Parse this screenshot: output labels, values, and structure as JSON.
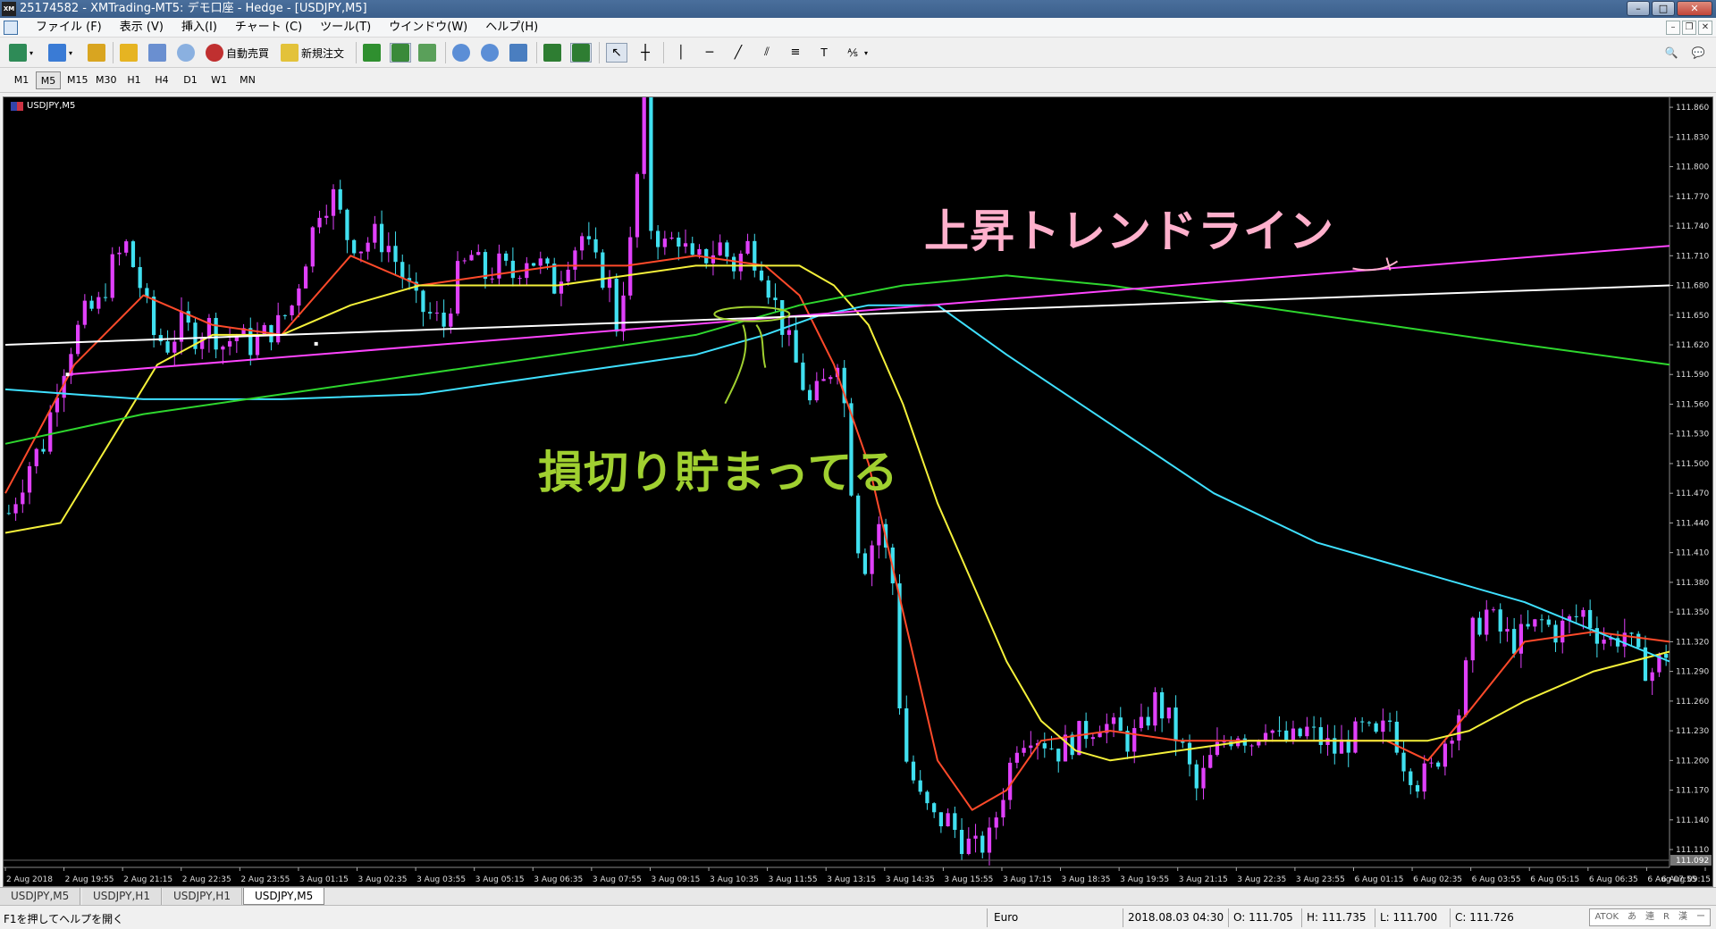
{
  "window": {
    "app_icon": "XM",
    "title": "25174582 - XMTrading-MT5: デモ口座 - Hedge - [USDJPY,M5]",
    "buttons": [
      "–",
      "□",
      "✕"
    ]
  },
  "menu": {
    "items": [
      "ファイル (F)",
      "表示 (V)",
      "挿入(I)",
      "チャート (C)",
      "ツール(T)",
      "ウインドウ(W)",
      "ヘルプ(H)"
    ],
    "mdi_buttons": [
      "–",
      "❐",
      "✕"
    ]
  },
  "toolbar": {
    "auto_trade_label": "自動売買",
    "new_order_label": "新規注文"
  },
  "timeframes": [
    "M1",
    "M5",
    "M15",
    "M30",
    "H1",
    "H4",
    "D1",
    "W1",
    "MN"
  ],
  "active_timeframe": "M5",
  "chart": {
    "symbol_label": "USDJPY,M5",
    "annotation_trend": "上昇トレンドライン",
    "annotation_stop": "損切り貯まってる",
    "current_price_label": "111.092"
  },
  "chart_data": {
    "type": "candlestick",
    "symbol": "USDJPY",
    "timeframe": "M5",
    "price_ticks": [
      "111.860",
      "111.830",
      "111.800",
      "111.770",
      "111.740",
      "111.710",
      "111.680",
      "111.650",
      "111.620",
      "111.590",
      "111.560",
      "111.530",
      "111.500",
      "111.470",
      "111.440",
      "111.410",
      "111.380",
      "111.350",
      "111.320",
      "111.290",
      "111.260",
      "111.230",
      "111.200",
      "111.170",
      "111.140",
      "111.110"
    ],
    "time_ticks": [
      "2 Aug 2018",
      "2 Aug 19:55",
      "2 Aug 21:15",
      "2 Aug 22:35",
      "2 Aug 23:55",
      "3 Aug 01:15",
      "3 Aug 02:35",
      "3 Aug 03:55",
      "3 Aug 05:15",
      "3 Aug 06:35",
      "3 Aug 07:55",
      "3 Aug 09:15",
      "3 Aug 10:35",
      "3 Aug 11:55",
      "3 Aug 13:15",
      "3 Aug 14:35",
      "3 Aug 15:55",
      "3 Aug 17:15",
      "3 Aug 18:35",
      "3 Aug 19:55",
      "3 Aug 21:15",
      "3 Aug 22:35",
      "3 Aug 23:55",
      "6 Aug 01:15",
      "6 Aug 02:35",
      "6 Aug 03:55",
      "6 Aug 05:15",
      "6 Aug 06:35",
      "6 Aug 07:55",
      "6 Aug 09:15"
    ],
    "ylim": [
      111.092,
      111.87
    ],
    "close_path": [
      [
        0,
        111.45
      ],
      [
        3,
        111.5
      ],
      [
        5,
        111.52
      ],
      [
        7,
        111.58
      ],
      [
        9,
        111.62
      ],
      [
        11,
        111.65
      ],
      [
        13,
        111.66
      ],
      [
        15,
        111.7
      ],
      [
        17,
        111.72
      ],
      [
        19,
        111.68
      ],
      [
        21,
        111.63
      ],
      [
        23,
        111.62
      ],
      [
        25,
        111.64
      ],
      [
        27,
        111.63
      ],
      [
        29,
        111.64
      ],
      [
        31,
        111.62
      ],
      [
        33,
        111.63
      ],
      [
        35,
        111.62
      ],
      [
        37,
        111.63
      ],
      [
        39,
        111.64
      ],
      [
        41,
        111.66
      ],
      [
        43,
        111.71
      ],
      [
        45,
        111.76
      ],
      [
        47,
        111.77
      ],
      [
        49,
        111.73
      ],
      [
        51,
        111.72
      ],
      [
        53,
        111.73
      ],
      [
        55,
        111.72
      ],
      [
        57,
        111.69
      ],
      [
        59,
        111.66
      ],
      [
        61,
        111.65
      ],
      [
        63,
        111.64
      ],
      [
        65,
        111.69
      ],
      [
        67,
        111.71
      ],
      [
        69,
        111.69
      ],
      [
        71,
        111.7
      ],
      [
        73,
        111.69
      ],
      [
        75,
        111.71
      ],
      [
        77,
        111.7
      ],
      [
        79,
        111.68
      ],
      [
        81,
        111.71
      ],
      [
        83,
        111.73
      ],
      [
        85,
        111.7
      ],
      [
        87,
        111.68
      ],
      [
        88,
        111.64
      ],
      [
        90,
        111.72
      ],
      [
        92,
        111.86
      ],
      [
        93,
        111.74
      ],
      [
        95,
        111.72
      ],
      [
        97,
        111.73
      ],
      [
        99,
        111.7
      ],
      [
        101,
        111.71
      ],
      [
        103,
        111.72
      ],
      [
        105,
        111.7
      ],
      [
        107,
        111.72
      ],
      [
        109,
        111.7
      ],
      [
        111,
        111.66
      ],
      [
        112,
        111.64
      ],
      [
        114,
        111.6
      ],
      [
        116,
        111.56
      ],
      [
        118,
        111.58
      ],
      [
        120,
        111.61
      ],
      [
        121,
        111.56
      ],
      [
        122,
        111.48
      ],
      [
        123,
        111.42
      ],
      [
        124,
        111.4
      ],
      [
        126,
        111.44
      ],
      [
        128,
        111.38
      ],
      [
        129,
        111.26
      ],
      [
        130,
        111.2
      ],
      [
        132,
        111.16
      ],
      [
        134,
        111.14
      ],
      [
        136,
        111.14
      ],
      [
        138,
        111.12
      ],
      [
        140,
        111.11
      ],
      [
        142,
        111.12
      ],
      [
        144,
        111.17
      ],
      [
        146,
        111.22
      ],
      [
        148,
        111.23
      ],
      [
        150,
        111.22
      ],
      [
        152,
        111.21
      ],
      [
        154,
        111.22
      ],
      [
        156,
        111.23
      ],
      [
        158,
        111.24
      ],
      [
        160,
        111.23
      ],
      [
        162,
        111.22
      ],
      [
        164,
        111.23
      ],
      [
        166,
        111.26
      ],
      [
        168,
        111.24
      ],
      [
        170,
        111.21
      ],
      [
        172,
        111.17
      ],
      [
        174,
        111.2
      ],
      [
        176,
        111.22
      ],
      [
        178,
        111.23
      ],
      [
        180,
        111.22
      ],
      [
        182,
        111.24
      ],
      [
        184,
        111.22
      ],
      [
        186,
        111.22
      ],
      [
        188,
        111.23
      ],
      [
        190,
        111.22
      ],
      [
        192,
        111.21
      ],
      [
        194,
        111.22
      ],
      [
        196,
        111.23
      ],
      [
        198,
        111.22
      ],
      [
        200,
        111.24
      ],
      [
        202,
        111.2
      ],
      [
        204,
        111.18
      ],
      [
        206,
        111.19
      ],
      [
        208,
        111.22
      ],
      [
        210,
        111.25
      ],
      [
        212,
        111.33
      ],
      [
        214,
        111.35
      ],
      [
        216,
        111.33
      ],
      [
        218,
        111.32
      ],
      [
        220,
        111.33
      ],
      [
        222,
        111.34
      ],
      [
        224,
        111.33
      ],
      [
        226,
        111.34
      ],
      [
        228,
        111.35
      ],
      [
        230,
        111.33
      ],
      [
        232,
        111.32
      ],
      [
        234,
        111.33
      ],
      [
        236,
        111.3
      ],
      [
        238,
        111.29
      ],
      [
        240,
        111.31
      ],
      [
        241,
        111.28
      ]
    ],
    "series": [
      {
        "name": "",
        "color": "#ff4a2a",
        "values": [
          [
            0,
            111.47
          ],
          [
            10,
            111.6
          ],
          [
            20,
            111.67
          ],
          [
            30,
            111.64
          ],
          [
            40,
            111.63
          ],
          [
            50,
            111.71
          ],
          [
            60,
            111.68
          ],
          [
            70,
            111.69
          ],
          [
            80,
            111.7
          ],
          [
            90,
            111.7
          ],
          [
            100,
            111.71
          ],
          [
            110,
            111.7
          ],
          [
            115,
            111.67
          ],
          [
            120,
            111.6
          ],
          [
            125,
            111.5
          ],
          [
            130,
            111.35
          ],
          [
            135,
            111.2
          ],
          [
            140,
            111.15
          ],
          [
            145,
            111.17
          ],
          [
            150,
            111.22
          ],
          [
            160,
            111.23
          ],
          [
            170,
            111.22
          ],
          [
            180,
            111.22
          ],
          [
            190,
            111.22
          ],
          [
            200,
            111.22
          ],
          [
            206,
            111.2
          ],
          [
            212,
            111.25
          ],
          [
            220,
            111.32
          ],
          [
            230,
            111.33
          ],
          [
            241,
            111.32
          ]
        ]
      },
      {
        "name": "",
        "color": "#f4f03a",
        "values": [
          [
            0,
            111.43
          ],
          [
            8,
            111.44
          ],
          [
            15,
            111.52
          ],
          [
            22,
            111.6
          ],
          [
            30,
            111.63
          ],
          [
            40,
            111.63
          ],
          [
            50,
            111.66
          ],
          [
            60,
            111.68
          ],
          [
            70,
            111.68
          ],
          [
            80,
            111.68
          ],
          [
            90,
            111.69
          ],
          [
            100,
            111.7
          ],
          [
            110,
            111.7
          ],
          [
            115,
            111.7
          ],
          [
            120,
            111.68
          ],
          [
            125,
            111.64
          ],
          [
            130,
            111.56
          ],
          [
            135,
            111.46
          ],
          [
            140,
            111.38
          ],
          [
            145,
            111.3
          ],
          [
            150,
            111.24
          ],
          [
            155,
            111.21
          ],
          [
            160,
            111.2
          ],
          [
            170,
            111.21
          ],
          [
            180,
            111.22
          ],
          [
            190,
            111.22
          ],
          [
            200,
            111.22
          ],
          [
            206,
            111.22
          ],
          [
            212,
            111.23
          ],
          [
            220,
            111.26
          ],
          [
            230,
            111.29
          ],
          [
            241,
            111.31
          ]
        ]
      },
      {
        "name": "",
        "color": "#3fe0ff",
        "values": [
          [
            0,
            111.575
          ],
          [
            20,
            111.565
          ],
          [
            40,
            111.565
          ],
          [
            60,
            111.57
          ],
          [
            70,
            111.58
          ],
          [
            80,
            111.59
          ],
          [
            90,
            111.6
          ],
          [
            100,
            111.61
          ],
          [
            110,
            111.63
          ],
          [
            118,
            111.65
          ],
          [
            125,
            111.66
          ],
          [
            135,
            111.66
          ],
          [
            145,
            111.61
          ],
          [
            160,
            111.54
          ],
          [
            175,
            111.47
          ],
          [
            190,
            111.42
          ],
          [
            205,
            111.39
          ],
          [
            220,
            111.36
          ],
          [
            241,
            111.3
          ]
        ]
      },
      {
        "name": "",
        "color": "#2ed62e",
        "values": [
          [
            0,
            111.52
          ],
          [
            20,
            111.55
          ],
          [
            40,
            111.57
          ],
          [
            60,
            111.59
          ],
          [
            80,
            111.61
          ],
          [
            100,
            111.63
          ],
          [
            115,
            111.66
          ],
          [
            130,
            111.68
          ],
          [
            145,
            111.69
          ],
          [
            160,
            111.68
          ],
          [
            180,
            111.66
          ],
          [
            200,
            111.64
          ],
          [
            220,
            111.62
          ],
          [
            241,
            111.6
          ]
        ]
      }
    ],
    "trendlines": [
      {
        "color": "#ff44ff",
        "from": [
          9,
          111.59
        ],
        "to": [
          241,
          111.72
        ]
      },
      {
        "color": "#ffffff",
        "from": [
          0,
          111.62
        ],
        "to": [
          241,
          111.68
        ]
      }
    ]
  },
  "tabs": [
    "USDJPY,M5",
    "USDJPY,H1",
    "USDJPY,H1",
    "USDJPY,M5"
  ],
  "active_tab": 3,
  "status": {
    "help": "F1を押してヘルプを開く",
    "profile": "Euro",
    "time": "2018.08.03 04:30",
    "open": "O: 111.705",
    "high": "H: 111.735",
    "low": "L: 111.700",
    "close": "C: 111.726",
    "ime": [
      "ATOK",
      "あ",
      "連",
      "R",
      "漢",
      "ー"
    ]
  }
}
